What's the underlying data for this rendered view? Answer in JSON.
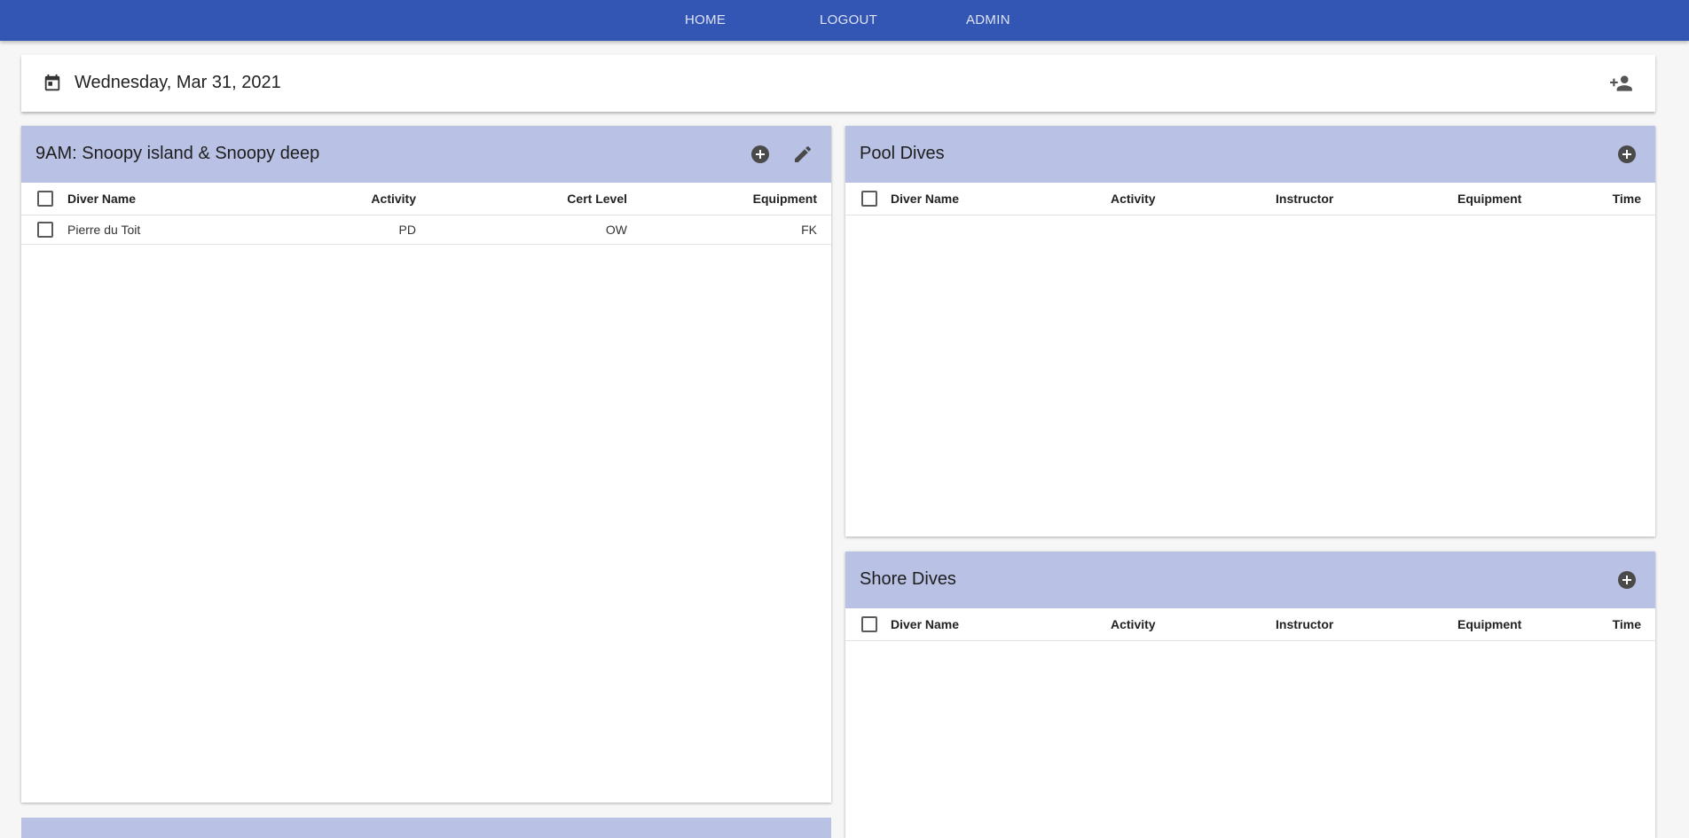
{
  "nav": {
    "home": "HOME",
    "logout": "LOGOUT",
    "admin": "ADMIN"
  },
  "datebar": {
    "date": "Wednesday, Mar 31, 2021",
    "icon": "calendar-icon",
    "action_icon": "person-add-icon"
  },
  "boat_card": {
    "title": "9AM: Snoopy island & Snoopy deep",
    "columns": [
      "Diver Name",
      "Activity",
      "Cert Level",
      "Equipment"
    ],
    "rows": [
      {
        "diver": "Pierre du Toit",
        "activity": "PD",
        "cert": "OW",
        "equipment": "FK"
      }
    ]
  },
  "pool_card": {
    "title": "Pool Dives",
    "columns": [
      "Diver Name",
      "Activity",
      "Instructor",
      "Equipment",
      "Time"
    ]
  },
  "shore_card": {
    "title": "Shore Dives",
    "columns": [
      "Diver Name",
      "Activity",
      "Instructor",
      "Equipment",
      "Time"
    ]
  },
  "colors": {
    "topbar": "#3355b3",
    "card_header": "#b9c1e4",
    "icon": "#444444"
  }
}
